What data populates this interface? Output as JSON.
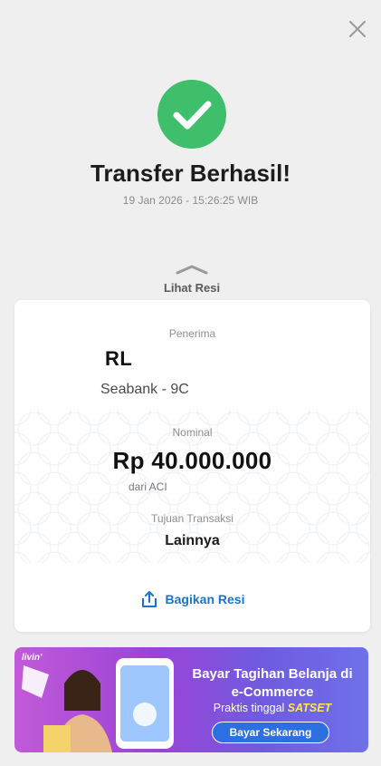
{
  "header": {
    "close_icon": "close-icon"
  },
  "status": {
    "icon": "check-circle-icon",
    "title": "Transfer Berhasil!",
    "datetime": "19 Jan 2026 - 15:26:25 WIB",
    "color": "#3fbf6b"
  },
  "receipt_toggle": {
    "label": "Lihat Resi",
    "icon": "chevron-up-icon"
  },
  "receipt": {
    "recipient_label": "Penerima",
    "recipient_name": "RL",
    "recipient_bank": "Seabank - 9C",
    "amount_label": "Nominal",
    "amount": "Rp 40.000.000",
    "source": "dari ACI",
    "purpose_label": "Tujuan Transaksi",
    "purpose": "Lainnya",
    "share_label": "Bagikan Resi",
    "share_icon": "share-icon",
    "accent": "#1a73c9"
  },
  "promo": {
    "logo": "livin'",
    "headline": "Bayar Tagihan Belanja di e-Commerce",
    "subline_prefix": "Praktis tinggal",
    "subline_highlight": "SATSET",
    "cta_label": "Bayar Sekarang"
  }
}
